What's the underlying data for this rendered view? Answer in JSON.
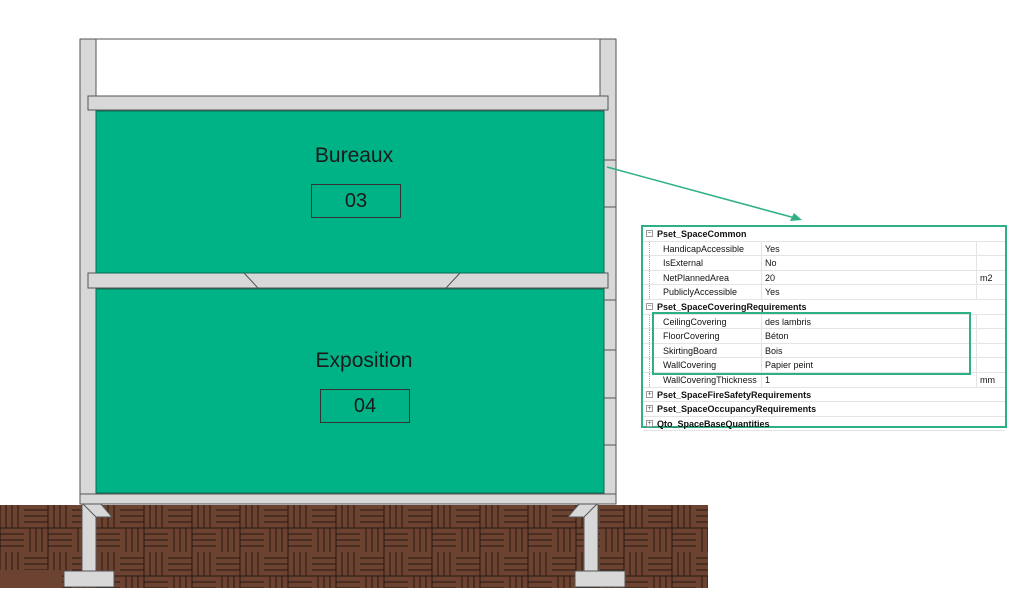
{
  "colors": {
    "room_fill": "#00b386",
    "structure": "#d8d8d8",
    "accent": "#2db183",
    "ground": "#6b4330"
  },
  "rooms": [
    {
      "name": "Bureaux",
      "number": "03"
    },
    {
      "name": "Exposition",
      "number": "04"
    }
  ],
  "properties": {
    "psets": [
      {
        "name": "Pset_SpaceCommon",
        "expanded": true,
        "props": [
          {
            "name": "HandicapAccessible",
            "value": "Yes",
            "unit": ""
          },
          {
            "name": "IsExternal",
            "value": "No",
            "unit": ""
          },
          {
            "name": "NetPlannedArea",
            "value": "20",
            "unit": "m2"
          },
          {
            "name": "PubliclyAccessible",
            "value": "Yes",
            "unit": ""
          }
        ]
      },
      {
        "name": "Pset_SpaceCoveringRequirements",
        "expanded": true,
        "props": [
          {
            "name": "CeilingCovering",
            "value": "des lambris",
            "unit": ""
          },
          {
            "name": "FloorCovering",
            "value": "Béton",
            "unit": ""
          },
          {
            "name": "SkirtingBoard",
            "value": "Bois",
            "unit": ""
          },
          {
            "name": "WallCovering",
            "value": "Papier peint",
            "unit": ""
          },
          {
            "name": "WallCoveringThickness",
            "value": "1",
            "unit": "mm"
          }
        ]
      },
      {
        "name": "Pset_SpaceFireSafetyRequirements",
        "expanded": false,
        "props": []
      },
      {
        "name": "Pset_SpaceOccupancyRequirements",
        "expanded": false,
        "props": []
      },
      {
        "name": "Qto_SpaceBaseQuantities",
        "expanded": false,
        "props": []
      }
    ]
  }
}
